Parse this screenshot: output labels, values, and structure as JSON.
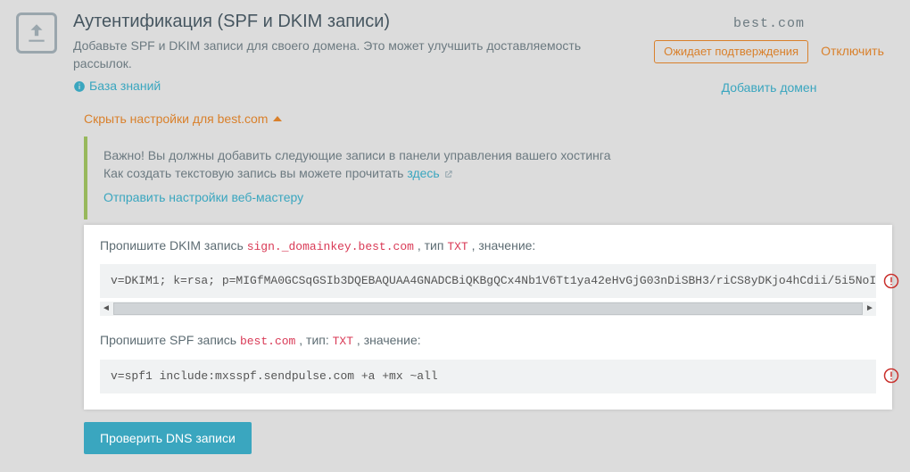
{
  "header": {
    "title": "Аутентификация (SPF и DKIM записи)",
    "subtitle": "Добавьте SPF и DKIM записи для своего домена. Это может улучшить доставляемость рассылок.",
    "kb_link": "База знаний"
  },
  "domain": {
    "name": "best.com",
    "status_badge": "Ожидает подтверждения",
    "disable_link": "Отключить",
    "add_domain_link": "Добавить домен"
  },
  "toggle_label": "Скрыть настройки для best.com",
  "notice": {
    "line1": "Важно! Вы должны добавить следующие записи в панели управления вашего хостинга",
    "line2_prefix": "Как создать текстовую запись вы можете прочитать ",
    "line2_link": "здесь",
    "send_link": "Отправить настройки веб-мастеру"
  },
  "dkim": {
    "label_prefix": "Пропишите DKIM запись ",
    "record_name": "sign._domainkey.best.com",
    "label_mid": ", тип ",
    "record_type": "TXT",
    "label_suffix": ", значение:",
    "value": "v=DKIM1; k=rsa; p=MIGfMA0GCSqGSIb3DQEBAQUAA4GNADCBiQKBgQCx4Nb1V6Tt1ya42eHvGjG03nDiSBH3/riCS8yDKjo4hCdii/5i5NoI"
  },
  "spf": {
    "label_prefix": "Пропишите SPF запись ",
    "record_name": "best.com",
    "label_mid": ", тип: ",
    "record_type": "TXT",
    "label_suffix": ", значение:",
    "value": "v=spf1 include:mxsspf.sendpulse.com +a +mx ~all"
  },
  "check_button": "Проверить DNS записи"
}
